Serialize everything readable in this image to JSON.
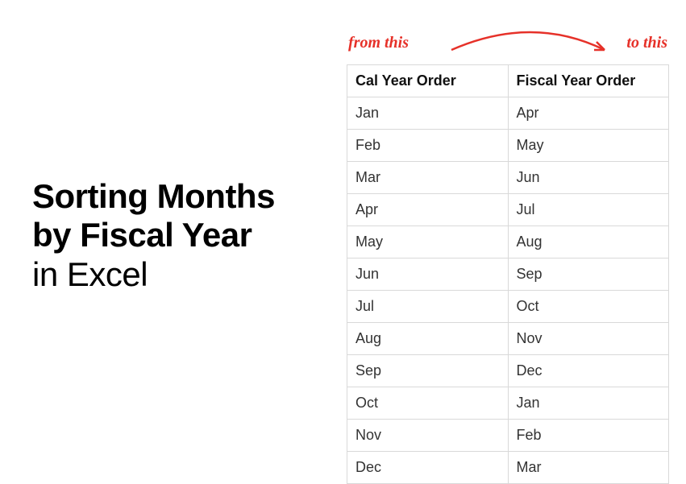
{
  "title": {
    "line1": "Sorting Months",
    "line2": "by Fiscal Year",
    "line3": "in Excel"
  },
  "annotations": {
    "from": "from this",
    "to": "to this"
  },
  "table": {
    "headers": {
      "col1": "Cal Year Order",
      "col2": "Fiscal Year Order"
    },
    "rows": [
      {
        "cal": "Jan",
        "fis": "Apr"
      },
      {
        "cal": "Feb",
        "fis": "May"
      },
      {
        "cal": "Mar",
        "fis": "Jun"
      },
      {
        "cal": "Apr",
        "fis": "Jul"
      },
      {
        "cal": "May",
        "fis": "Aug"
      },
      {
        "cal": "Jun",
        "fis": "Sep"
      },
      {
        "cal": "Jul",
        "fis": "Oct"
      },
      {
        "cal": "Aug",
        "fis": "Nov"
      },
      {
        "cal": "Sep",
        "fis": "Dec"
      },
      {
        "cal": "Oct",
        "fis": "Jan"
      },
      {
        "cal": "Nov",
        "fis": "Feb"
      },
      {
        "cal": "Dec",
        "fis": "Mar"
      }
    ]
  }
}
